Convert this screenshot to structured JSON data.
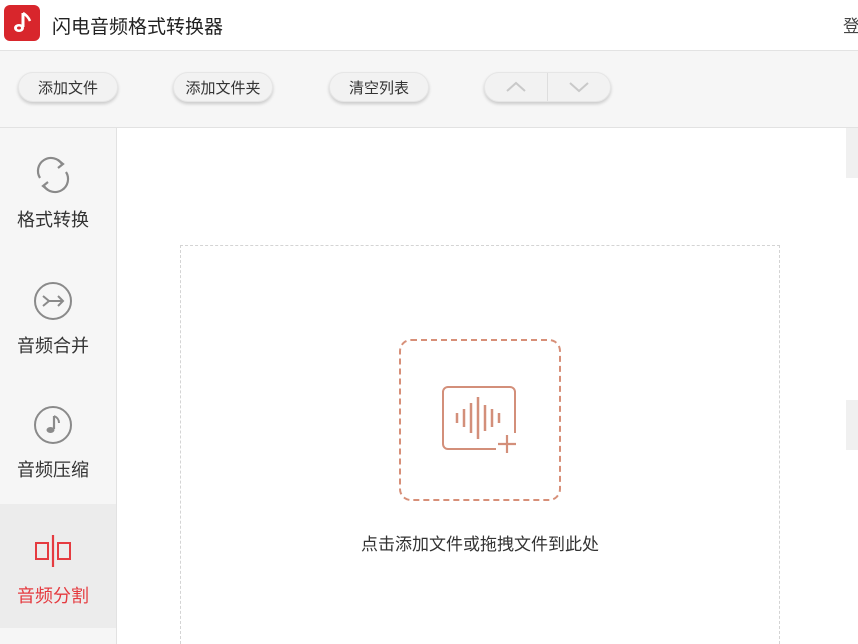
{
  "app": {
    "title": "闪电音频格式转换器",
    "login_label": "登"
  },
  "toolbar": {
    "add_file": "添加文件",
    "add_folder": "添加文件夹",
    "clear_list": "清空列表"
  },
  "sidebar": {
    "items": [
      {
        "label": "格式转换",
        "icon": "refresh-icon",
        "active": false
      },
      {
        "label": "音频合并",
        "icon": "merge-icon",
        "active": false
      },
      {
        "label": "音频压缩",
        "icon": "music-note-icon",
        "active": false
      },
      {
        "label": "音频分割",
        "icon": "split-icon",
        "active": true
      }
    ]
  },
  "main": {
    "drop_hint": "点击添加文件或拖拽文件到此处"
  },
  "colors": {
    "brand_red": "#d8262c",
    "active_text": "#e53b40",
    "dashed_accent": "#d78f78"
  }
}
